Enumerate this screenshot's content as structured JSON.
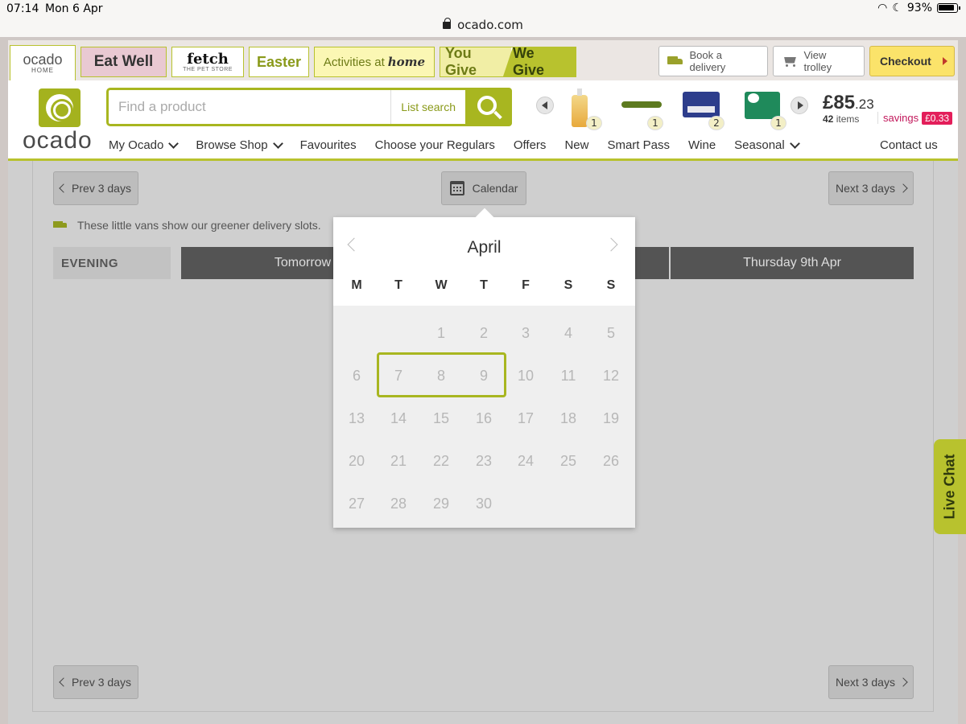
{
  "status_bar": {
    "time": "07:14",
    "date": "Mon 6 Apr",
    "battery": "93%",
    "url": "ocado.com"
  },
  "brand_tabs": {
    "home_title": "ocado",
    "home_sub": "HOME",
    "eat_well": "Eat Well",
    "fetch_title": "fetch",
    "fetch_sub": "THE PET STORE",
    "easter": "Easter",
    "activities": "Activities at",
    "activities_home": "home",
    "you_give": "You Give",
    "we_give": "We Give"
  },
  "header_buttons": {
    "book": "Book a delivery",
    "trolley": "View trolley",
    "checkout": "Checkout"
  },
  "logo": {
    "word": "ocado"
  },
  "search": {
    "placeholder": "Find a product",
    "list_search": "List search"
  },
  "trolley_preview": {
    "products": [
      {
        "icon": "hand-wash-bottle",
        "qty": "1"
      },
      {
        "icon": "cucumber",
        "qty": "1"
      },
      {
        "icon": "butter-pack",
        "qty": "2"
      },
      {
        "icon": "yoghurt-pot",
        "qty": "1"
      }
    ],
    "total_pounds": "£85",
    "total_pence": ".23",
    "item_count": "42",
    "items_label": "items",
    "savings_label": "savings",
    "savings_value": "£0.33"
  },
  "nav": {
    "items": [
      "My Ocado",
      "Browse Shop",
      "Favourites",
      "Choose your Regulars",
      "Offers",
      "New",
      "Smart Pass",
      "Wine",
      "Seasonal"
    ],
    "contact": "Contact us"
  },
  "slots": {
    "prev": "Prev 3 days",
    "next": "Next 3 days",
    "calendar": "Calendar",
    "vans_note": "These little vans show our greener delivery slots.",
    "period": "EVENING",
    "days": [
      "Tomorrow",
      "",
      "Thursday 9th Apr"
    ]
  },
  "calendar_popup": {
    "month": "April",
    "weekdays": [
      "M",
      "T",
      "W",
      "T",
      "F",
      "S",
      "S"
    ],
    "weeks": [
      [
        "",
        "",
        "1",
        "2",
        "3",
        "4",
        "5"
      ],
      [
        "6",
        "7",
        "8",
        "9",
        "10",
        "11",
        "12"
      ],
      [
        "13",
        "14",
        "15",
        "16",
        "17",
        "18",
        "19"
      ],
      [
        "20",
        "21",
        "22",
        "23",
        "24",
        "25",
        "26"
      ],
      [
        "27",
        "28",
        "29",
        "30",
        "",
        "",
        ""
      ]
    ],
    "highlighted_days": [
      "7",
      "8",
      "9"
    ]
  },
  "live_chat": "Live Chat",
  "colors": {
    "brand_green": "#a8b620",
    "savings_pink": "#e31e5a",
    "checkout_yellow": "#fbe36a"
  }
}
